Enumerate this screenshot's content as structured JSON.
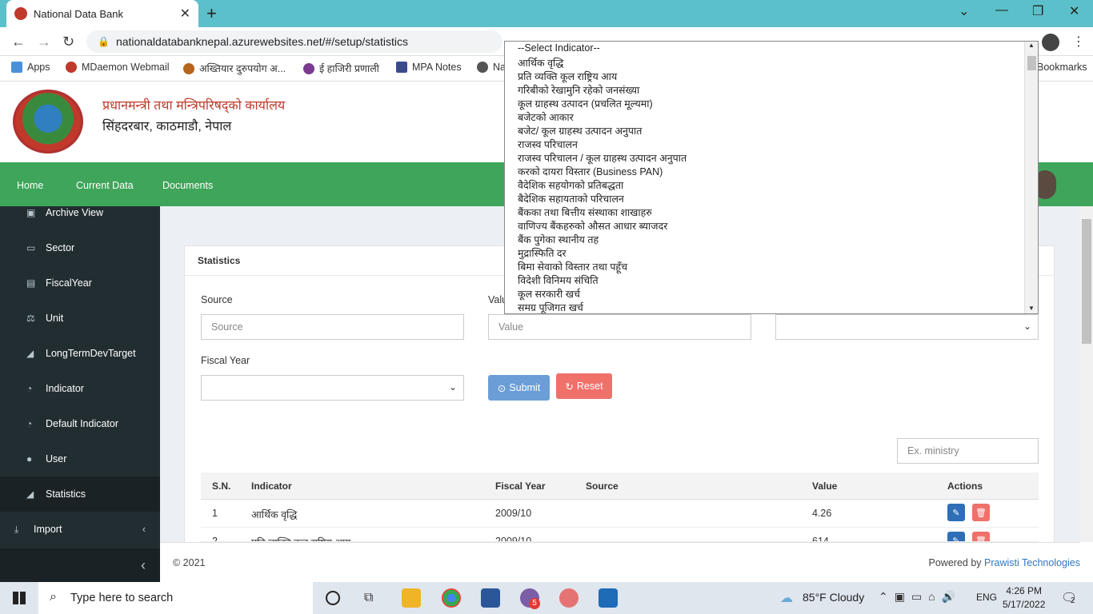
{
  "browser": {
    "tab_title": "National Data Bank",
    "url": "nationaldatabanknepal.azurewebsites.net/#/setup/statistics",
    "bookmarks": [
      "Apps",
      "MDaemon Webmail",
      "अख्तियार दुरुपयोग अ...",
      "ई हाजिरी प्रणाली",
      "MPA Notes",
      "Na",
      "Bookmarks"
    ]
  },
  "header": {
    "org_line1": "प्रधानमन्त्री तथा मन्त्रिपरिषद्को कार्यालय",
    "org_line2": "सिंहदरबार, काठमाडौ, नेपाल"
  },
  "nav": {
    "home": "Home",
    "current": "Current Data",
    "documents": "Documents"
  },
  "sidebar": {
    "items": [
      {
        "label": "Archive View"
      },
      {
        "label": "Sector"
      },
      {
        "label": "FiscalYear"
      },
      {
        "label": "Unit"
      },
      {
        "label": "LongTermDevTarget"
      },
      {
        "label": "Indicator"
      },
      {
        "label": "Default Indicator"
      },
      {
        "label": "User"
      },
      {
        "label": "Statistics"
      },
      {
        "label": "Import"
      }
    ]
  },
  "card": {
    "title": "Statistics",
    "source_label": "Source",
    "source_placeholder": "Source",
    "value_label": "Value",
    "value_placeholder": "Value",
    "fiscal_label": "Fiscal Year",
    "submit": "Submit",
    "reset": "Reset",
    "filter_placeholder": "Ex. ministry"
  },
  "table": {
    "headers": [
      "S.N.",
      "Indicator",
      "Fiscal Year",
      "Source",
      "Value",
      "Actions"
    ],
    "rows": [
      {
        "sn": "1",
        "indicator": "आर्थिक वृद्धि",
        "fy": "2009/10",
        "source": "",
        "value": "4.26"
      },
      {
        "sn": "2",
        "indicator": "प्रति व्यक्ति कूल राष्ट्रिय आय",
        "fy": "2009/10",
        "source": "",
        "value": "614"
      }
    ]
  },
  "dropdown": {
    "options": [
      "--Select Indicator--",
      "आर्थिक वृद्धि",
      "प्रति व्यक्ति कूल राष्ट्रिय आय",
      "गरिबीको रेखामुनि रहेको जनसंख्या",
      "कूल ग्राहस्थ उत्पादन (प्रचलित मूल्यमा)",
      "बजेटको आकार",
      "बजेट/ कूल ग्राहस्थ उत्पादन अनुपात",
      "राजस्व परिचालन",
      "राजस्व परिचालन / कूल ग्राहस्थ उत्पादन अनुपात",
      "करको दायरा विस्तार (Business PAN)",
      "वैदेशिक सहयोगको प्रतिबद्धता",
      "बैदेशिक सहायताको परिचालन",
      "बैंकका तथा बित्तीय संस्थाका शाखाहरु",
      "वाणिज्य बैंकहरुको औसत आधार ब्याजदर",
      "बैंक पुगेका स्थानीय तह",
      "मुद्रास्फिति दर",
      "बिमा सेवाको विस्तार तथा पहूँच",
      "विदेशी विनिमय संचिति",
      "कूल सरकारी खर्च",
      "समग्र पूजिगत खर्च"
    ]
  },
  "footer": {
    "copy": "© 2021",
    "powered": "Powered by",
    "company": "Prawisti Technologies"
  },
  "taskbar": {
    "search": "Type here to search",
    "weather": "85°F  Cloudy",
    "lang": "ENG",
    "time": "4:26 PM",
    "date": "5/17/2022",
    "notif": "2",
    "badge": "5"
  }
}
